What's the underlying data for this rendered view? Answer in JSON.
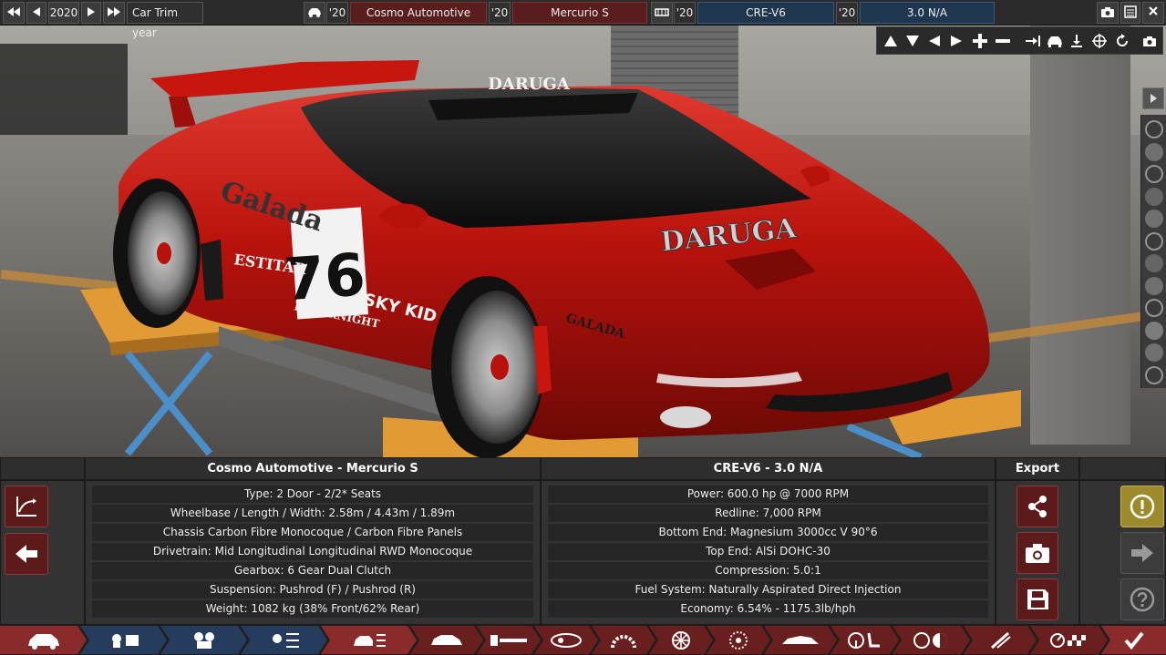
{
  "topbar": {
    "year": "2020",
    "trim_label": "Car Trim year",
    "model_year_1": "'20",
    "manufacturer": "Cosmo Automotive",
    "model_year_2": "'20",
    "model": "Mercurio S",
    "engine_year_1": "'20",
    "engine_family": "CRE-V6",
    "engine_year_2": "'20",
    "engine_variant": "3.0 N/A"
  },
  "car_livery": {
    "number": "76",
    "sponsor_1": "Galada",
    "sponsor_2": "DARUGA",
    "sponsor_3": "ESTITAR",
    "sponsor_4": "HYPERNIGHT",
    "sponsor_5": "SKY KID",
    "sponsor_6": "GALADA"
  },
  "car_panel": {
    "title": "Cosmo Automotive - Mercurio S",
    "rows": [
      "Type: 2 Door - 2/2* Seats",
      "Wheelbase / Length / Width: 2.58m / 4.43m / 1.89m",
      "Chassis Carbon Fibre Monocoque / Carbon Fibre Panels",
      "Drivetrain: Mid Longitudinal Longitudinal RWD Monocoque",
      "Gearbox: 6 Gear Dual Clutch",
      "Suspension: Pushrod (F) / Pushrod (R)",
      "Weight: 1082 kg (38% Front/62% Rear)"
    ]
  },
  "engine_panel": {
    "title": "CRE-V6 - 3.0 N/A",
    "rows": [
      "Power: 600.0 hp @ 7000 RPM",
      "Redline:  7,000 RPM",
      "Bottom End: Magnesium 3000cc V 90°6",
      "Top End: AlSi DOHC-30",
      "Compression: 5.0:1",
      "Fuel System: Naturally Aspirated Direct Injection",
      "Economy: 6.54% - 1175.3lb/hph"
    ]
  },
  "export_panel": {
    "title": "Export"
  },
  "colors": {
    "accent_red": "#6a1f1f",
    "accent_blue": "#253c5c",
    "warning": "#9d8a2a",
    "car_red": "#c0140f"
  }
}
